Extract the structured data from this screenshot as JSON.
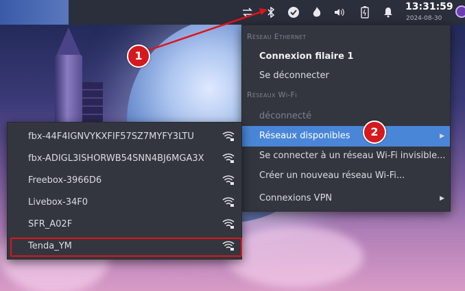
{
  "tray": {
    "icons": [
      "network-transfer-icon",
      "bluetooth-icon",
      "check-circle-icon",
      "flame-icon",
      "volume-icon",
      "battery-icon",
      "bell-icon"
    ],
    "time": "13:31:59",
    "date": "2024-08-30"
  },
  "menu": {
    "ethernet_header": "Réseau Ethernet",
    "ethernet_connection": "Connexion filaire 1",
    "disconnect": "Se déconnecter",
    "wifi_header": "Réseaux Wi-Fi",
    "wifi_status": "déconnecté",
    "available_networks": "Réseaux disponibles",
    "connect_hidden": "Se connecter à un réseau Wi-Fi invisible...",
    "create_new": "Créer un nouveau réseau Wi-Fi...",
    "vpn": "Connexions VPN"
  },
  "wifi_networks": [
    {
      "ssid": "fbx-44F4IGNVYKXFIF57SZ7MYFY3LTU"
    },
    {
      "ssid": "fbx-ADIGL3ISHORWB54SNN4BJ6MGA3X"
    },
    {
      "ssid": "Freebox-3966D6"
    },
    {
      "ssid": "Livebox-34F0"
    },
    {
      "ssid": "SFR_A02F"
    },
    {
      "ssid": "Tenda_YM"
    }
  ],
  "annotations": {
    "badge1": "1",
    "badge2": "2"
  },
  "colors": {
    "selection": "#4a86d8",
    "annotation_red": "#d6191d",
    "menu_bg": "#33363f"
  }
}
